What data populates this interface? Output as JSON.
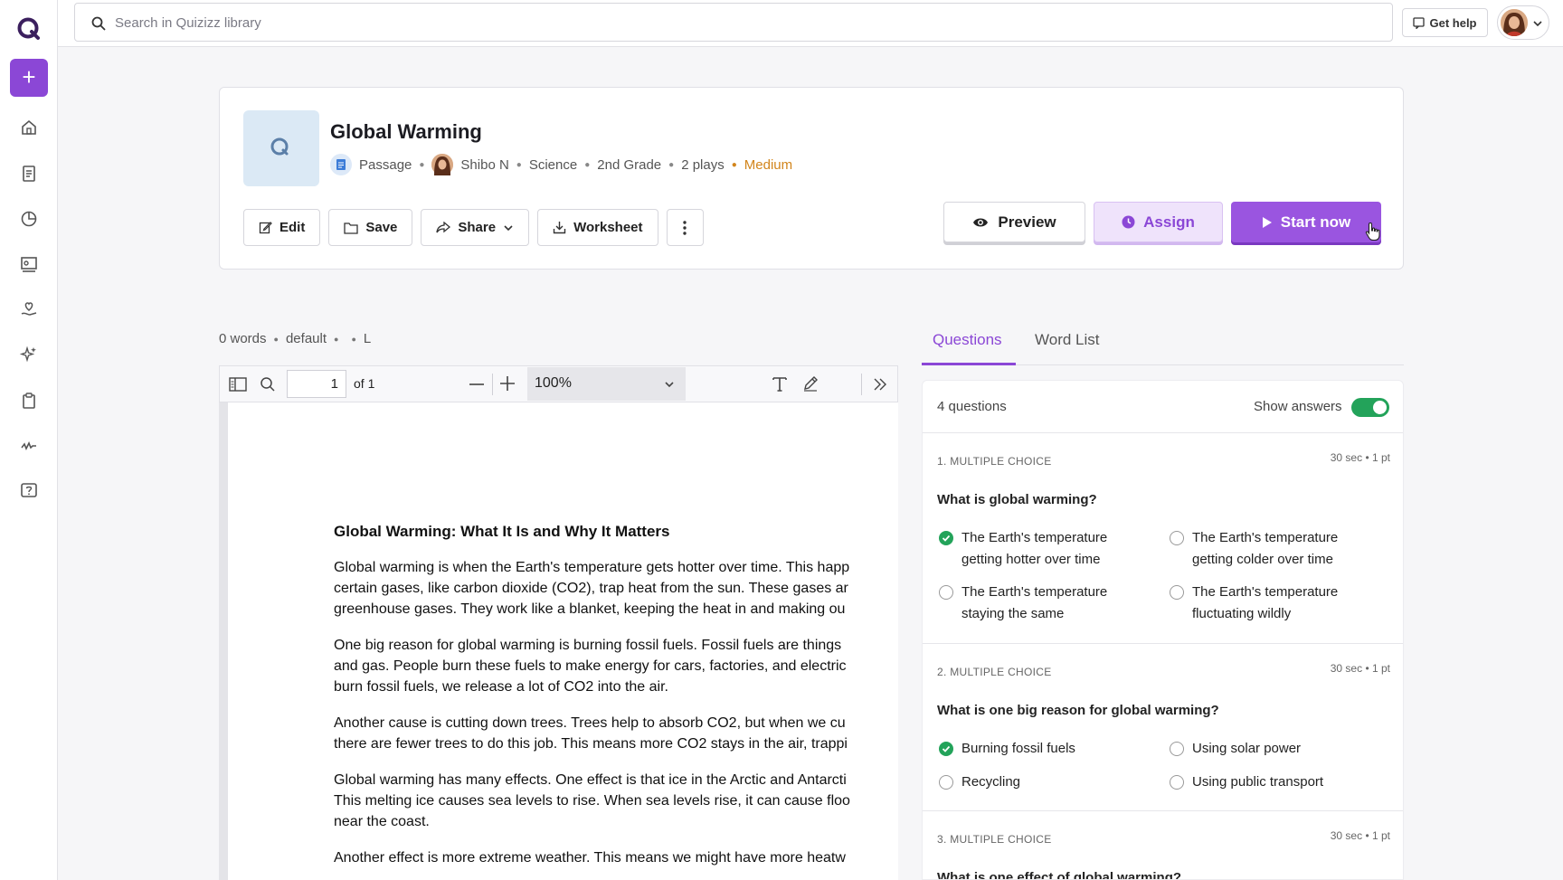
{
  "search": {
    "placeholder": "Search in Quizizz library"
  },
  "header": {
    "get_help": "Get help"
  },
  "quiz": {
    "title": "Global Warming",
    "type": "Passage",
    "author": "Shibo N",
    "subject": "Science",
    "grade": "2nd Grade",
    "plays": "2 plays",
    "difficulty": "Medium"
  },
  "toolbar": {
    "edit": "Edit",
    "save": "Save",
    "share": "Share",
    "worksheet": "Worksheet"
  },
  "actions": {
    "preview": "Preview",
    "assign": "Assign",
    "start": "Start now"
  },
  "viewer_info": {
    "words": "0 words",
    "style": "default",
    "size": "L"
  },
  "pdf": {
    "page": "1",
    "of": "of 1",
    "zoom": "100%",
    "heading": "Global Warming: What It Is and Why It Matters",
    "paragraphs": [
      [
        "Global warming is when the Earth's temperature gets hotter over time. This happ",
        "certain gases, like carbon dioxide (CO2), trap heat from the sun. These gases ar",
        "greenhouse gases. They work like a blanket, keeping the heat in and making ou"
      ],
      [
        "One big reason for global warming is burning fossil fuels. Fossil fuels are things",
        "and gas. People burn these fuels to make energy for cars, factories, and electric",
        "burn fossil fuels, we release a lot of CO2 into the air."
      ],
      [
        "Another cause is cutting down trees. Trees help to absorb CO2, but when we cu",
        "there are fewer trees to do this job. This means more CO2 stays in the air, trappi"
      ],
      [
        "Global warming has many effects. One effect is that ice in the Arctic and Antarcti",
        "This melting ice causes sea levels to rise. When sea levels rise, it can cause floo",
        "near the coast."
      ],
      [
        "Another effect is more extreme weather. This means we might have more heatw"
      ]
    ]
  },
  "tabs": [
    "Questions",
    "Word List"
  ],
  "questions_panel": {
    "count": "4 questions",
    "show_answers": "Show answers",
    "show_answers_on": true,
    "questions": [
      {
        "type": "1. MULTIPLE CHOICE",
        "meta": "30 sec • 1 pt",
        "text": "What is global warming?",
        "options": [
          {
            "label": "The Earth's temperature getting hotter over time",
            "correct": true
          },
          {
            "label": "The Earth's temperature getting colder over time",
            "correct": false
          },
          {
            "label": "The Earth's temperature staying the same",
            "correct": false
          },
          {
            "label": "The Earth's temperature fluctuating wildly",
            "correct": false
          }
        ]
      },
      {
        "type": "2. MULTIPLE CHOICE",
        "meta": "30 sec • 1 pt",
        "text": "What is one big reason for global warming?",
        "options": [
          {
            "label": "Burning fossil fuels",
            "correct": true
          },
          {
            "label": "Using solar power",
            "correct": false
          },
          {
            "label": "Recycling",
            "correct": false
          },
          {
            "label": "Using public transport",
            "correct": false
          }
        ]
      },
      {
        "type": "3. MULTIPLE CHOICE",
        "meta": "30 sec • 1 pt",
        "text": "What is one effect of global warming?"
      }
    ]
  },
  "colors": {
    "brand": "#8b47d6",
    "correct": "#23a35a",
    "medium": "#d2851c"
  }
}
